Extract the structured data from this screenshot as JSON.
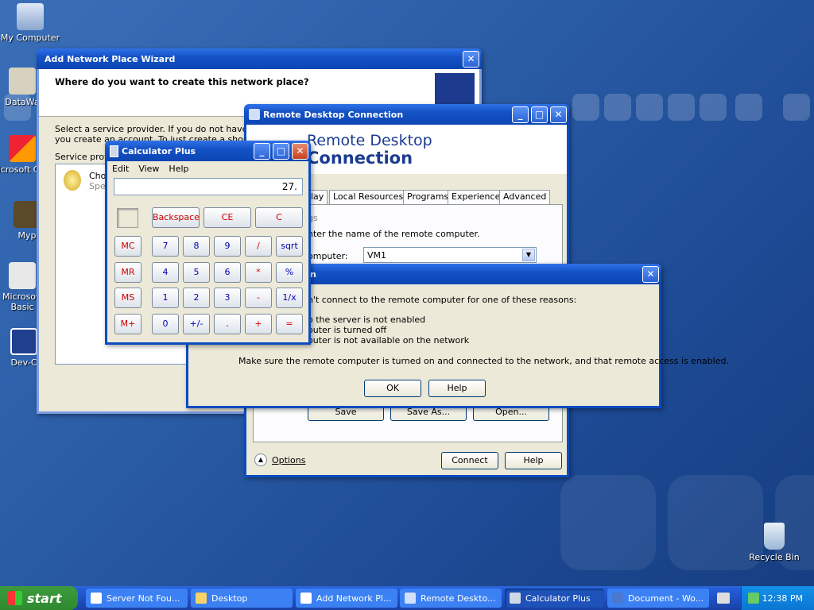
{
  "desktop_icons": [
    {
      "label": "My Computer"
    },
    {
      "label": "DataWa"
    },
    {
      "label": "Microsoft C++"
    },
    {
      "label": "Myp"
    },
    {
      "label": "Microsoft Basic"
    },
    {
      "label": "Dev-C"
    },
    {
      "label": "Recycle Bin"
    }
  ],
  "wizard": {
    "title": "Add Network Place Wizard",
    "heading": "Where do you want to create this network place?",
    "text1": "Select a service provider.  If you do not have a me",
    "text2": "you create an account. To just create a shortcut",
    "list_label": "Service provi",
    "item_title": "Choo",
    "item_sub": "Spec"
  },
  "rdc": {
    "title": "Remote Desktop Connection",
    "banner1": "Remote Desktop",
    "banner2": "Connection",
    "tabs": [
      "lay",
      "Local Resources",
      "Programs",
      "Experience",
      "Advanced"
    ],
    "group": "gs",
    "instruction": "nter the name of the remote computer.",
    "computer_label": "omputer:",
    "computer_value": "VM1",
    "save": "Save",
    "save_as": "Save As...",
    "open": "Open...",
    "options": "Options",
    "connect": "Connect",
    "help": "Help"
  },
  "error": {
    "title": "n",
    "line1": "n't connect to the remote computer for one of these reasons:",
    "reason1": "o the server is not enabled",
    "reason2": "outer is turned off",
    "reason3": "outer is not available on the network",
    "message": "Make sure the remote computer is turned on and connected to the network, and that remote access is enabled.",
    "ok": "OK",
    "help": "Help"
  },
  "calc": {
    "title": "Calculator Plus",
    "menu": [
      "Edit",
      "View",
      "Help"
    ],
    "display": "27.",
    "top": [
      "Backspace",
      "CE",
      "C"
    ],
    "mem": [
      "MC",
      "MR",
      "MS",
      "M+"
    ],
    "rows": [
      [
        "7",
        "8",
        "9",
        "/",
        "sqrt"
      ],
      [
        "4",
        "5",
        "6",
        "*",
        "%"
      ],
      [
        "1",
        "2",
        "3",
        "-",
        "1/x"
      ],
      [
        "0",
        "+/-",
        ".",
        "+",
        "="
      ]
    ]
  },
  "taskbar": {
    "start": "start",
    "tasks": [
      "Server Not Fou...",
      "Desktop",
      "Add Network Pl...",
      "Remote Deskto...",
      "Calculator Plus",
      "Document - Wo..."
    ],
    "clock": "12:38 PM"
  }
}
